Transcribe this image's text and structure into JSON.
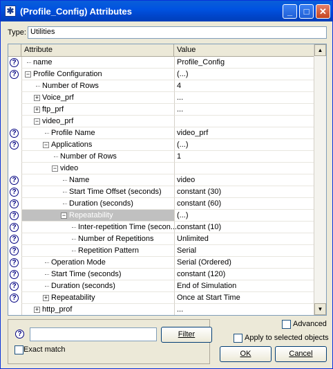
{
  "window": {
    "title": "(Profile_Config) Attributes",
    "title_icon": "star-app-icon",
    "buttons": [
      "minimize-icon",
      "maximize-icon",
      "close-icon"
    ]
  },
  "type_field": {
    "label": "Type:",
    "value": "Utilities"
  },
  "grid": {
    "columns": [
      "Attribute",
      "Value"
    ],
    "rows": [
      {
        "help": true,
        "indent": 0,
        "expander": "none",
        "label": "name",
        "value": "Profile_Config"
      },
      {
        "help": true,
        "indent": 0,
        "expander": "minus",
        "label": "Profile Configuration",
        "value": "(...)"
      },
      {
        "help": false,
        "indent": 1,
        "expander": "none",
        "label": "Number of Rows",
        "value": "4"
      },
      {
        "help": false,
        "indent": 1,
        "expander": "plus",
        "label": "Voice_prf",
        "value": "..."
      },
      {
        "help": false,
        "indent": 1,
        "expander": "plus",
        "label": "ftp_prf",
        "value": "..."
      },
      {
        "help": false,
        "indent": 1,
        "expander": "minus",
        "label": "video_prf",
        "value": ""
      },
      {
        "help": true,
        "indent": 2,
        "expander": "none",
        "label": "Profile Name",
        "value": "video_prf"
      },
      {
        "help": true,
        "indent": 2,
        "expander": "minus",
        "label": "Applications",
        "value": "(...)"
      },
      {
        "help": false,
        "indent": 3,
        "expander": "none",
        "label": "Number of Rows",
        "value": "1"
      },
      {
        "help": false,
        "indent": 3,
        "expander": "minus",
        "label": "video",
        "value": ""
      },
      {
        "help": true,
        "indent": 4,
        "expander": "none",
        "label": "Name",
        "value": "video"
      },
      {
        "help": true,
        "indent": 4,
        "expander": "none",
        "label": "Start Time Offset (seconds)",
        "value": "constant (30)"
      },
      {
        "help": true,
        "indent": 4,
        "expander": "none",
        "label": "Duration (seconds)",
        "value": "constant (60)"
      },
      {
        "help": true,
        "indent": 4,
        "expander": "minus",
        "label": "Repeatability",
        "value": "(...)",
        "selected": true
      },
      {
        "help": true,
        "indent": 5,
        "expander": "none",
        "label": "Inter-repetition Time (secon...",
        "value": "constant (10)"
      },
      {
        "help": true,
        "indent": 5,
        "expander": "none",
        "label": "Number of Repetitions",
        "value": "Unlimited"
      },
      {
        "help": true,
        "indent": 5,
        "expander": "none",
        "label": "Repetition Pattern",
        "value": "Serial"
      },
      {
        "help": true,
        "indent": 2,
        "expander": "none",
        "label": "Operation Mode",
        "value": "Serial (Ordered)"
      },
      {
        "help": true,
        "indent": 2,
        "expander": "none",
        "label": "Start Time (seconds)",
        "value": "constant (120)"
      },
      {
        "help": true,
        "indent": 2,
        "expander": "none",
        "label": "Duration (seconds)",
        "value": "End of Simulation"
      },
      {
        "help": true,
        "indent": 2,
        "expander": "plus",
        "label": "Repeatability",
        "value": "Once at Start Time"
      },
      {
        "help": false,
        "indent": 1,
        "expander": "plus",
        "label": "http_prof",
        "value": "..."
      }
    ]
  },
  "filter": {
    "value": "",
    "button_label": "Filter",
    "exact_match_label": "Exact match",
    "exact_match_checked": false
  },
  "options": {
    "advanced_label": "Advanced",
    "advanced_checked": false,
    "apply_selected_label": "Apply to selected objects",
    "apply_selected_checked": false
  },
  "dialog_buttons": {
    "ok_label": "OK",
    "cancel_label": "Cancel"
  }
}
